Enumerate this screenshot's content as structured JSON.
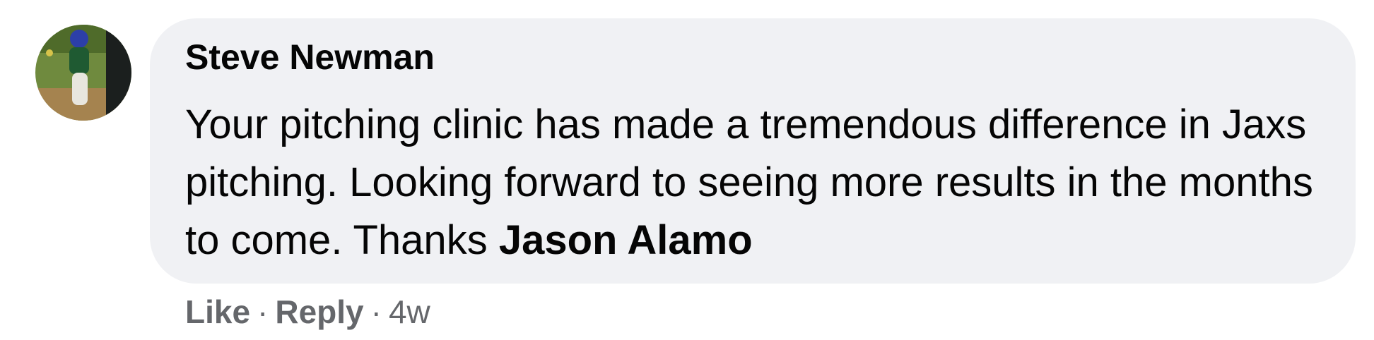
{
  "comment": {
    "author": "Steve Newman",
    "text_before_mention": "Your pitching clinic has made a tremendous difference in Jaxs pitching. Looking forward to seeing more results in the months to come. Thanks ",
    "mention": "Jason Alamo",
    "actions": {
      "like": "Like",
      "separator": "·",
      "reply": "Reply",
      "timestamp": "4w"
    }
  },
  "colors": {
    "bubble_background": "#f0f1f4",
    "text": "#050505",
    "secondary_text": "#65676b"
  }
}
